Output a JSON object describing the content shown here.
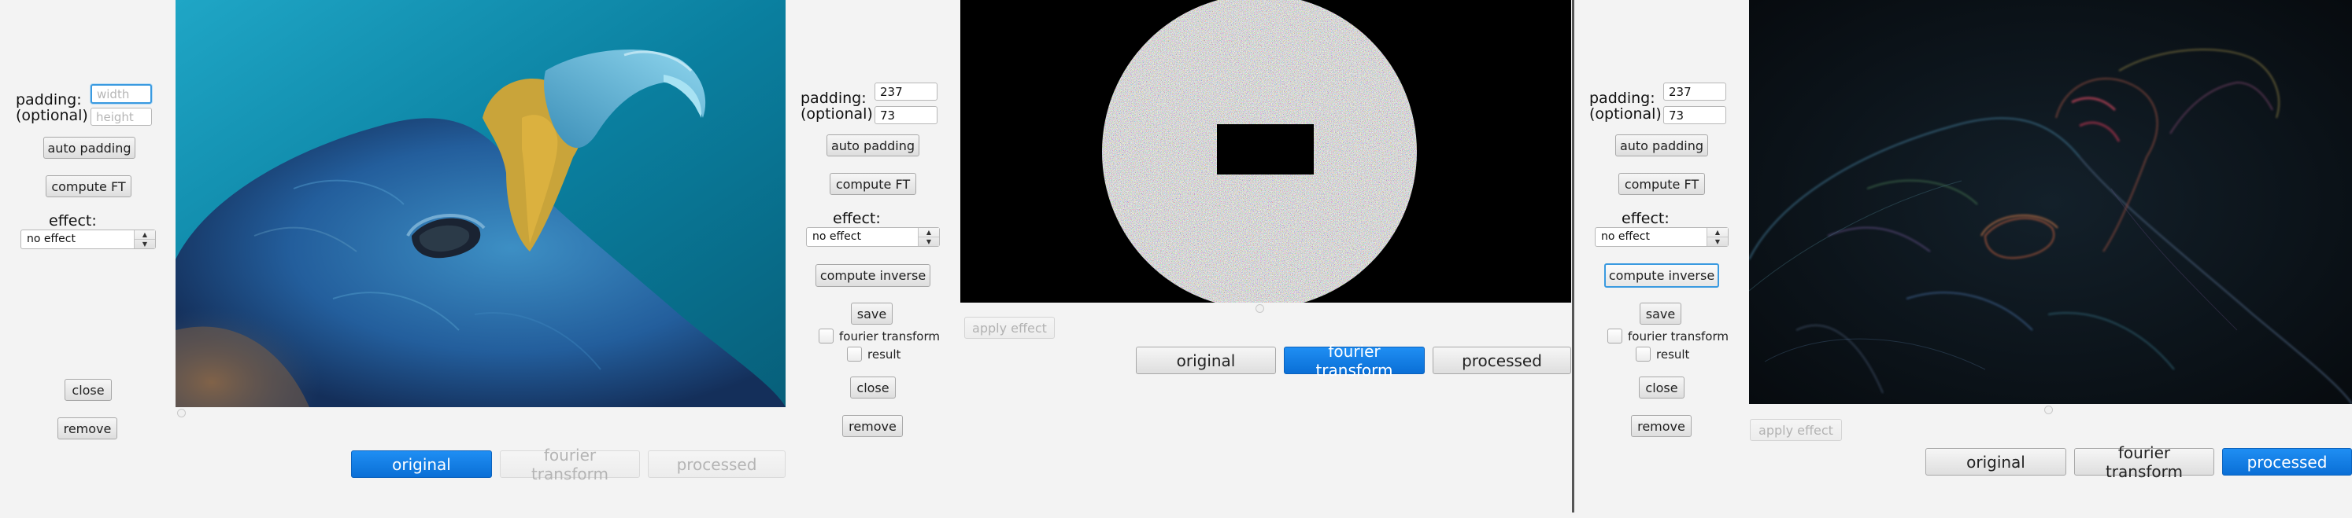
{
  "colors": {
    "accent": "#0a74da",
    "background": "#f3f3f3",
    "focus_ring": "#3a9ae0",
    "divider": "#555555"
  },
  "panel1": {
    "padding_label": "padding:",
    "optional_label": "(optional)",
    "width_value": "",
    "width_placeholder": "width",
    "height_value": "",
    "height_placeholder": "height",
    "auto_padding": "auto padding",
    "compute_ft": "compute FT",
    "effect_label": "effect:",
    "effect_value": "no effect",
    "close": "close",
    "remove": "remove",
    "tabs": {
      "original": "original",
      "fourier": "fourier transform",
      "processed": "processed"
    },
    "active_tab": "original",
    "image": "eagle-photo"
  },
  "panel2": {
    "padding_label": "padding:",
    "optional_label": "(optional)",
    "width_value": "237",
    "height_value": "73",
    "auto_padding": "auto padding",
    "compute_ft": "compute FT",
    "effect_label": "effect:",
    "effect_value": "no effect",
    "compute_inverse": "compute inverse",
    "save": "save",
    "fourier_checkbox": "fourier transform",
    "result_checkbox": "result",
    "close": "close",
    "remove": "remove",
    "apply_effect": "apply effect",
    "tabs": {
      "original": "original",
      "fourier": "fourier transform",
      "processed": "processed"
    },
    "active_tab": "fourier transform",
    "image": "fourier-spectrum-noise-disc"
  },
  "panel3": {
    "padding_label": "padding:",
    "optional_label": "(optional)",
    "width_value": "237",
    "height_value": "73",
    "auto_padding": "auto padding",
    "compute_ft": "compute FT",
    "effect_label": "effect:",
    "effect_value": "no effect",
    "compute_inverse": "compute inverse",
    "save": "save",
    "fourier_checkbox": "fourier transform",
    "result_checkbox": "result",
    "close": "close",
    "remove": "remove",
    "apply_effect": "apply effect",
    "tabs": {
      "original": "original",
      "fourier": "fourier transform",
      "processed": "processed"
    },
    "active_tab": "processed",
    "image": "eagle-edge-filtered"
  }
}
